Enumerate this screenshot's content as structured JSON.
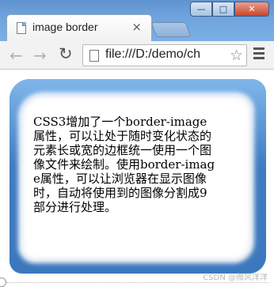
{
  "window": {
    "tab_title": "image border",
    "tab_close": "×",
    "minimize": "—",
    "maximize": "□",
    "close": "✕"
  },
  "toolbar": {
    "back": "←",
    "forward": "→",
    "reload": "↻",
    "url": "file:///D:/demo/ch",
    "star": "☆"
  },
  "content": {
    "text": "CSS3增加了一个border-image属性，可以让处于随时变化状态的元素长或宽的边框统一使用一个图像文件来绘制。使用border-image属性，可以让浏览器在显示图像时，自动将使用到的图像分割成9部分进行处理。",
    "watermark": "CSDN @微风洋洋"
  },
  "colors": {
    "border_blue": "#4a85c8",
    "titlebar_blue": "#6ea3dd"
  }
}
